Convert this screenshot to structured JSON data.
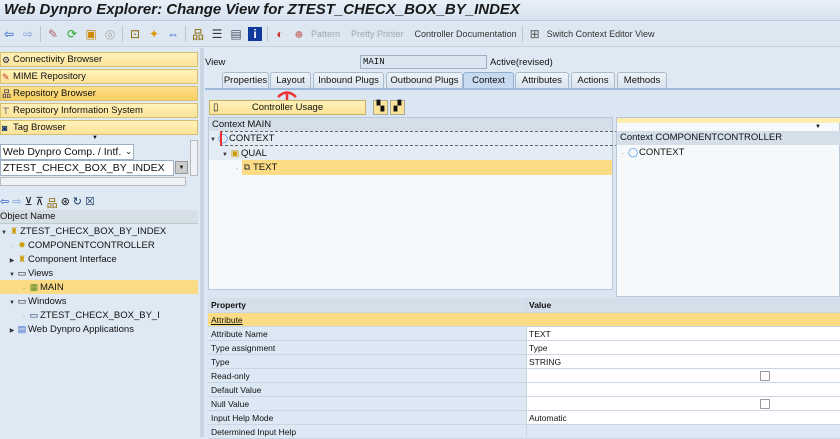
{
  "title": "Web Dynpro Explorer: Change View for ZTEST_CHECX_BOX_BY_INDEX",
  "toolbar": {
    "pattern": "Pattern",
    "pretty_printer": "Pretty Printer",
    "controller_doc": "Controller Documentation",
    "switch_context": "Switch Context Editor View"
  },
  "nav": {
    "items": [
      {
        "label": "Connectivity Browser"
      },
      {
        "label": "MIME Repository"
      },
      {
        "label": "Repository Browser"
      },
      {
        "label": "Repository Information System"
      },
      {
        "label": "Tag Browser"
      }
    ],
    "object_type": "Web Dynpro Comp. / Intf.",
    "object_value": "ZTEST_CHECX_BOX_BY_INDEX"
  },
  "tree": {
    "header": "Object Name",
    "items": [
      {
        "label": "ZTEST_CHECX_BOX_BY_INDEX"
      },
      {
        "label": "COMPONENTCONTROLLER"
      },
      {
        "label": "Component Interface"
      },
      {
        "label": "Views"
      },
      {
        "label": "MAIN"
      },
      {
        "label": "Windows"
      },
      {
        "label": "ZTEST_CHECX_BOX_BY_I"
      },
      {
        "label": "Web Dynpro Applications"
      }
    ]
  },
  "view": {
    "label": "View",
    "name": "MAIN",
    "status": "Active(revised)"
  },
  "tabs": [
    {
      "label": "Properties"
    },
    {
      "label": "Layout"
    },
    {
      "label": "Inbound Plugs"
    },
    {
      "label": "Outbound Plugs"
    },
    {
      "label": "Context"
    },
    {
      "label": "Attributes"
    },
    {
      "label": "Actions"
    },
    {
      "label": "Methods"
    }
  ],
  "context": {
    "controller_usage": "Controller Usage",
    "main_header": "Context MAIN",
    "main_nodes": [
      {
        "label": "CONTEXT"
      },
      {
        "label": "QUAL"
      },
      {
        "label": "TEXT"
      }
    ],
    "comp_header": "Context COMPONENTCONTROLLER",
    "comp_nodes": [
      {
        "label": "CONTEXT"
      }
    ]
  },
  "props": {
    "col_property": "Property",
    "col_value": "Value",
    "section": "Attribute",
    "rows": [
      {
        "p": "Attribute Name",
        "v": "TEXT"
      },
      {
        "p": "Type assignment",
        "v": "Type"
      },
      {
        "p": "Type",
        "v": "STRING"
      },
      {
        "p": "Read-only",
        "v": ""
      },
      {
        "p": "Default Value",
        "v": ""
      },
      {
        "p": "Null Value",
        "v": ""
      },
      {
        "p": "Input Help Mode",
        "v": "Automatic"
      },
      {
        "p": "Determined Input Help",
        "v": ""
      }
    ]
  }
}
